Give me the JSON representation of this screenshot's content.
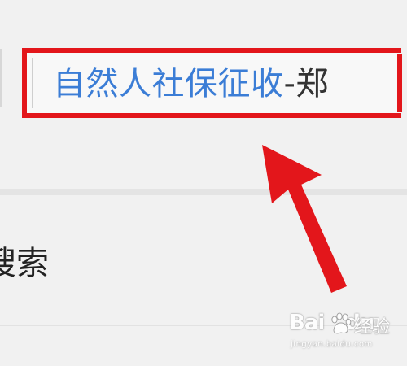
{
  "search_result": {
    "title_text": "自然人社保征收",
    "title_suffix": "-郑"
  },
  "search_menu": {
    "label": "搜索"
  },
  "watermark": {
    "brand_text": "Bai",
    "brand_text_tail": "du",
    "product_text": "经验",
    "url_text": "jingyan.baidu.com"
  },
  "colors": {
    "highlight_box": "#e3161b",
    "arrow": "#e3161b",
    "link_blue": "#3b7dd6",
    "background": "#f1f1f1"
  },
  "icons": {
    "annotation": "red-arrow-icon",
    "watermark": "baidu-paw-icon"
  }
}
